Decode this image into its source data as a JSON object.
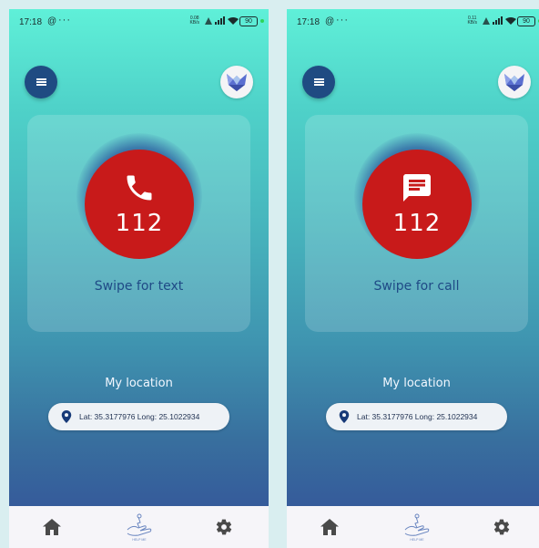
{
  "screens": [
    {
      "status": {
        "time": "17:18",
        "at": "@",
        "dots": "···",
        "speed_top": "0.08",
        "speed_bottom": "KB/s",
        "battery": "90"
      },
      "emergency": {
        "number": "112",
        "swipe_label": "Swipe for text",
        "mode_icon": "phone-icon"
      },
      "location": {
        "title": "My location",
        "coords": "Lat: 35.3177976 Long: 25.1022934"
      },
      "nav": {
        "logo_text": "HELP ME"
      }
    },
    {
      "status": {
        "time": "17:18",
        "at": "@",
        "dots": "···",
        "speed_top": "0.11",
        "speed_bottom": "KB/s",
        "battery": "90"
      },
      "emergency": {
        "number": "112",
        "swipe_label": "Swipe for call",
        "mode_icon": "message-icon"
      },
      "location": {
        "title": "My location",
        "coords": "Lat: 35.3177976 Long: 25.1022934"
      },
      "nav": {
        "logo_text": "HELP ME"
      }
    }
  ],
  "colors": {
    "sos_red": "#c81a1a",
    "navy": "#1f4b82",
    "label_blue": "#1f4a86"
  }
}
